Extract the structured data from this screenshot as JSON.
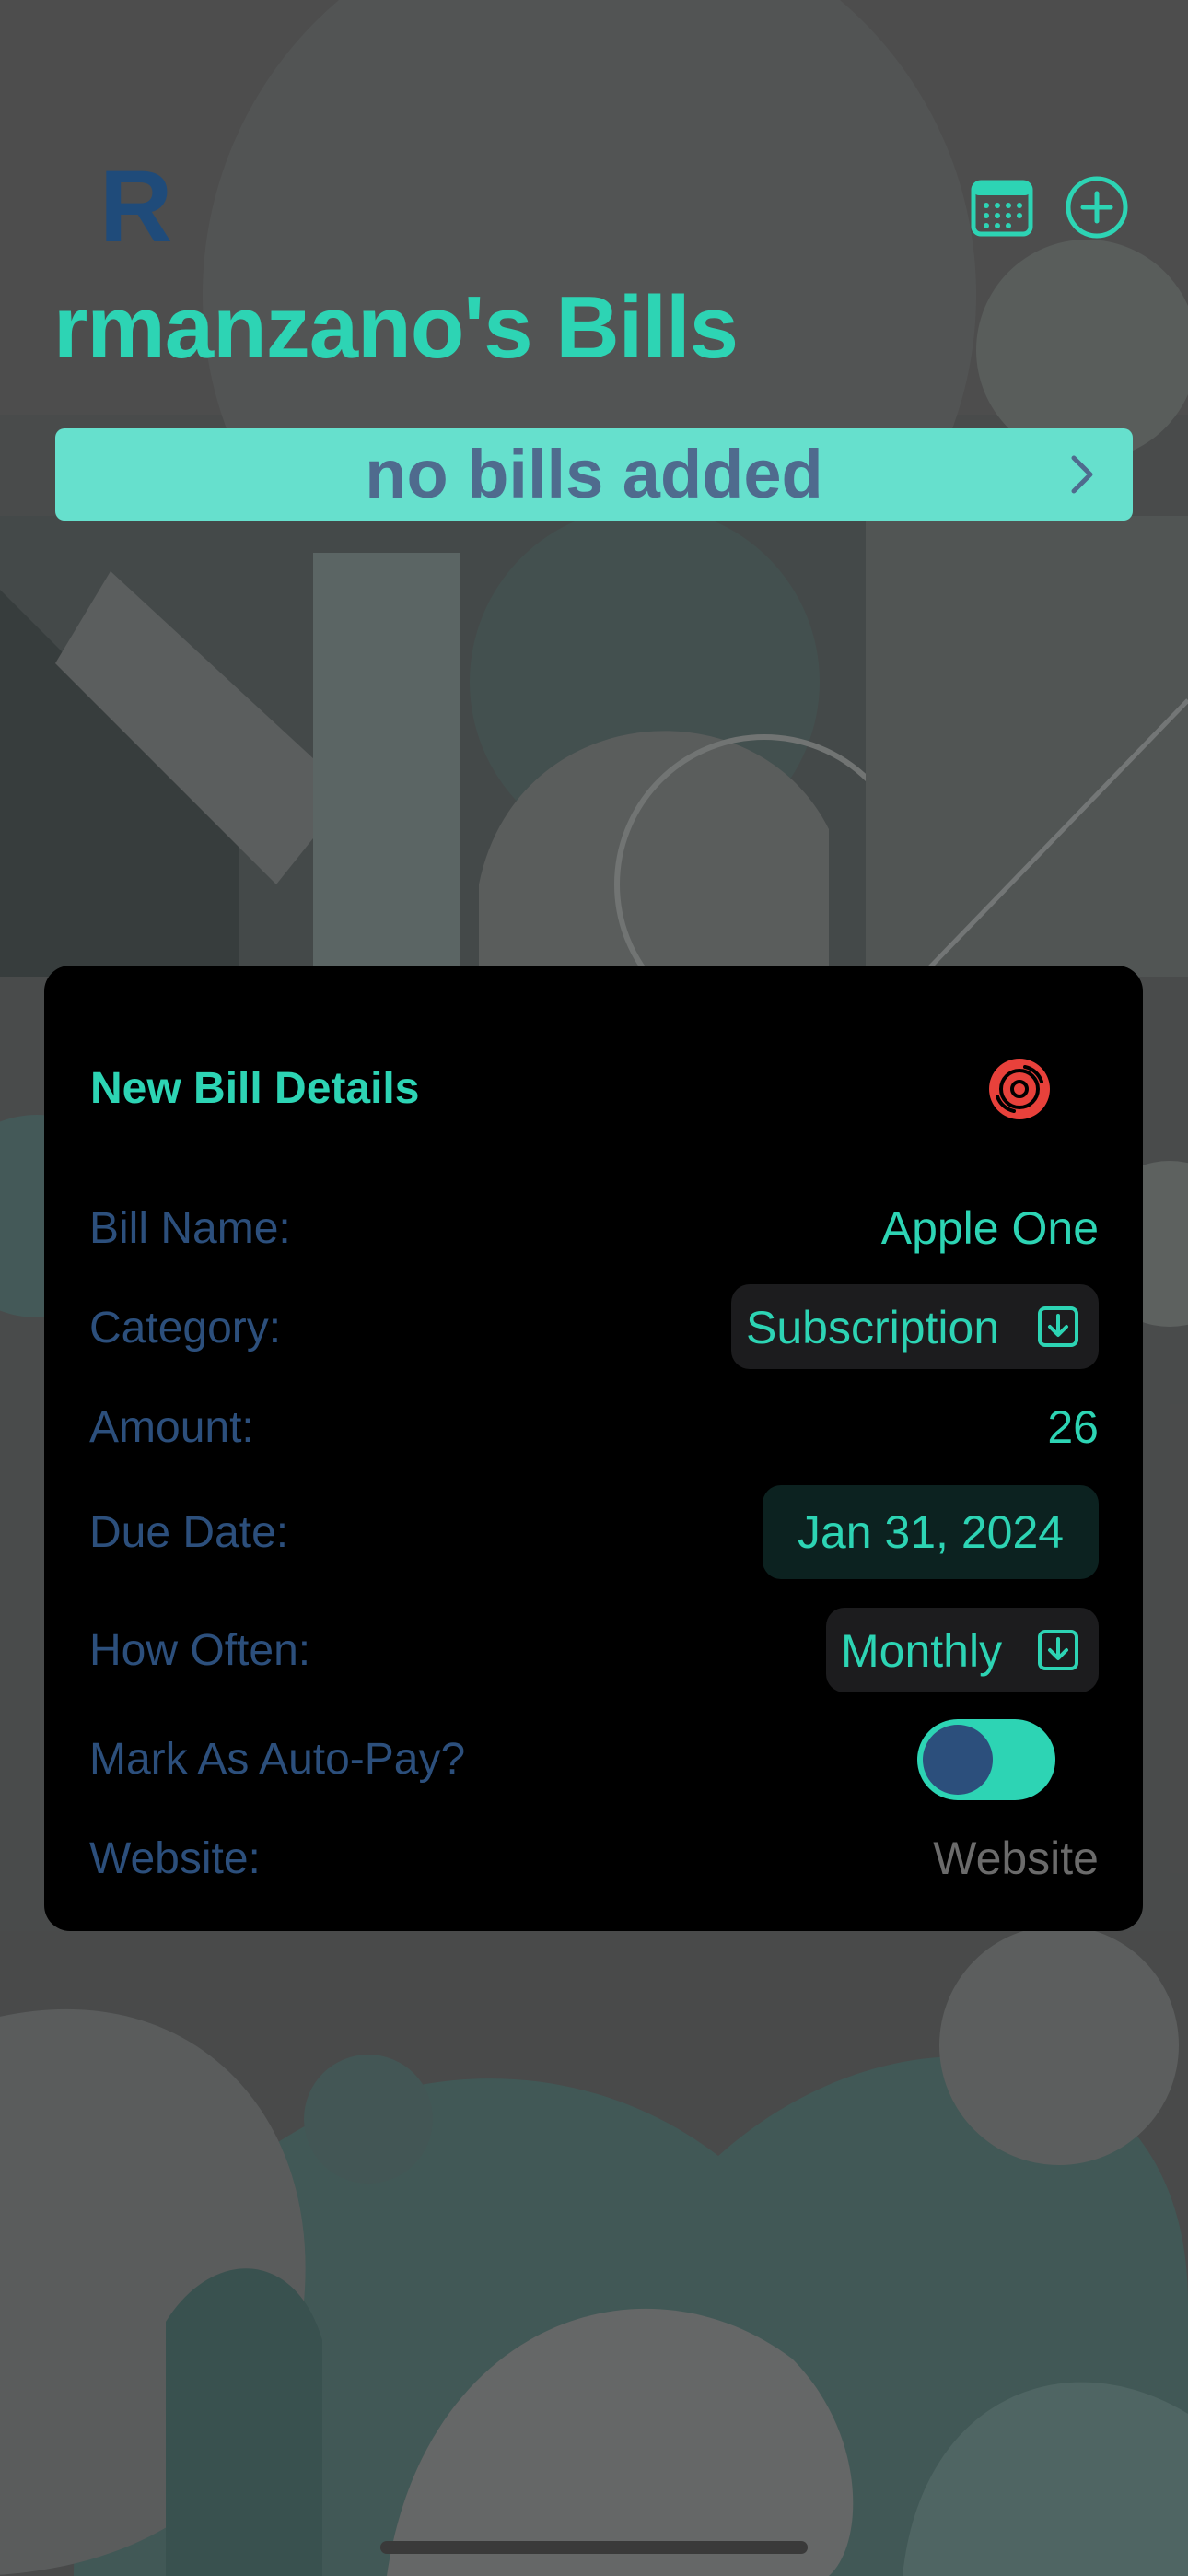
{
  "header": {
    "avatar_initial": "R",
    "title": "rmanzano's Bills",
    "calendar_icon": "calendar-icon",
    "add_icon": "plus-circle-icon"
  },
  "summary": {
    "text": "no bills added",
    "chevron_icon": "chevron-right-icon"
  },
  "card": {
    "title": "New Bill Details",
    "record_icon": "record-disc-icon",
    "rows": {
      "bill_name": {
        "label": "Bill Name:",
        "value": "Apple One"
      },
      "category": {
        "label": "Category:",
        "value": "Subscription",
        "icon": "download-box-icon"
      },
      "amount": {
        "label": "Amount:",
        "value": "26"
      },
      "due_date": {
        "label": "Due Date:",
        "value": "Jan 31, 2024"
      },
      "how_often": {
        "label": "How Often:",
        "value": "Monthly",
        "icon": "download-box-icon"
      },
      "auto_pay": {
        "label": "Mark As Auto-Pay?",
        "enabled": true
      },
      "website": {
        "label": "Website:",
        "placeholder": "Website",
        "value": ""
      }
    }
  },
  "colors": {
    "accent": "#2dd4b4",
    "label": "#2c4f7c",
    "summary_bg": "#66e0cd",
    "summary_text": "#4f6b8e",
    "record_red": "#e8413b",
    "card_bg": "#000000"
  }
}
